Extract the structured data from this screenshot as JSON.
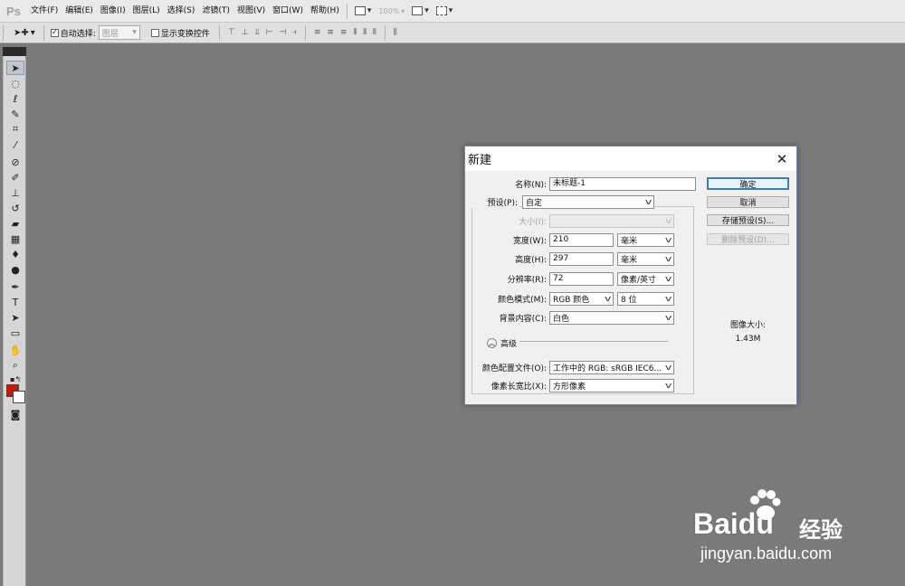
{
  "app": {
    "logo": "Ps"
  },
  "menu": [
    {
      "label": "文件(F)"
    },
    {
      "label": "编辑(E)"
    },
    {
      "label": "图像(I)"
    },
    {
      "label": "图层(L)"
    },
    {
      "label": "选择(S)"
    },
    {
      "label": "滤镜(T)"
    },
    {
      "label": "视图(V)"
    },
    {
      "label": "窗口(W)"
    },
    {
      "label": "帮助(H)"
    }
  ],
  "menu_right": {
    "zoom": "100%"
  },
  "options": {
    "auto_select_label": "自动选择:",
    "auto_select_checked": true,
    "auto_select_target": "图层",
    "show_transform_label": "显示变换控件",
    "show_transform_checked": false
  },
  "colors": {
    "foreground": "#c41b00",
    "background": "#ffffff",
    "accent": "#3c7fb1"
  },
  "dialog": {
    "title": "新建",
    "name_label": "名称(N):",
    "name_value": "未标题-1",
    "preset_label": "预设(P):",
    "preset_value": "自定",
    "size_label": "大小(I):",
    "size_value": "",
    "width_label": "宽度(W):",
    "width_value": "210",
    "width_unit": "毫米",
    "height_label": "高度(H):",
    "height_value": "297",
    "height_unit": "毫米",
    "resolution_label": "分辨率(R):",
    "resolution_value": "72",
    "resolution_unit": "像素/英寸",
    "color_mode_label": "颜色模式(M):",
    "color_mode_value": "RGB 颜色",
    "bit_depth_value": "8 位",
    "bg_content_label": "背景内容(C):",
    "bg_content_value": "白色",
    "advanced_label": "高级",
    "color_profile_label": "颜色配置文件(O):",
    "color_profile_value": "工作中的 RGB: sRGB IEC6...",
    "pixel_aspect_label": "像素长宽比(X):",
    "pixel_aspect_value": "方形像素",
    "buttons": {
      "ok": "确定",
      "cancel": "取消",
      "save_preset": "存储预设(S)...",
      "delete_preset": "删除预设(D)..."
    },
    "image_size_label": "图像大小:",
    "image_size_value": "1.43M"
  },
  "watermark": {
    "brand": "Baidu",
    "cn": "经验",
    "url": "jingyan.baidu.com"
  }
}
